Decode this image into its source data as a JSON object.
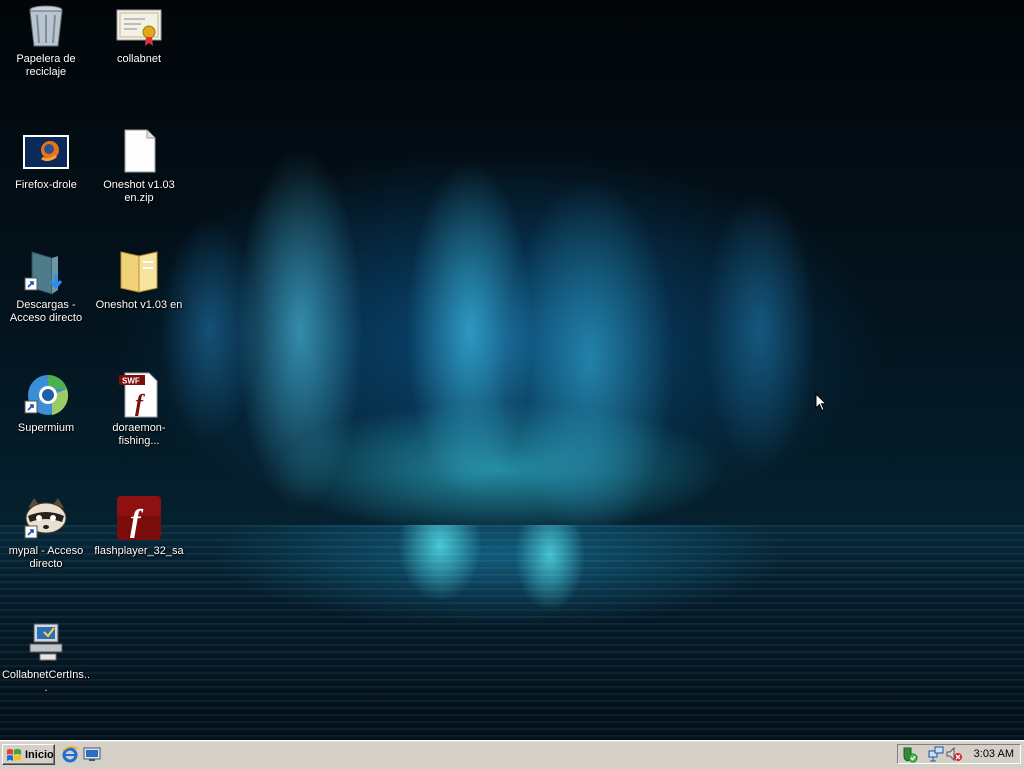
{
  "desktop_icons": [
    {
      "id": "recycle-bin",
      "label": "Papelera de reciclaje",
      "icon": "recycle-bin-icon"
    },
    {
      "id": "collabnet",
      "label": "collabnet",
      "icon": "certificate-icon"
    },
    {
      "id": "firefox-drole",
      "label": "Firefox-drole",
      "icon": "firefox-image-icon"
    },
    {
      "id": "oneshot-zip",
      "label": "Oneshot v1.03 en.zip",
      "icon": "blank-file-icon"
    },
    {
      "id": "descargas",
      "label": "Descargas - Acceso directo",
      "icon": "downloads-folder-shortcut-icon"
    },
    {
      "id": "oneshot-folder",
      "label": "Oneshot v1.03 en",
      "icon": "folder-icon"
    },
    {
      "id": "supermium",
      "label": "Supermium",
      "icon": "supermium-browser-icon"
    },
    {
      "id": "doraemon",
      "label": "doraemon-fishing...",
      "icon": "swf-file-icon"
    },
    {
      "id": "mypal",
      "label": "mypal - Acceso directo",
      "icon": "raccoon-shortcut-icon"
    },
    {
      "id": "flashplayer",
      "label": "flashplayer_32_sa",
      "icon": "flash-player-icon"
    },
    {
      "id": "collabnetcert",
      "label": "CollabnetCertIns...",
      "icon": "computer-install-icon"
    }
  ],
  "taskbar": {
    "start_label": "Inicio",
    "quick_launch": [
      "internet-explorer-icon",
      "show-desktop-icon"
    ],
    "tray_icons": [
      "security-shield-icon",
      "network-icon",
      "volume-muted-icon"
    ],
    "clock": "3:03 AM"
  },
  "colors": {
    "taskbar": "#d4d0c8",
    "flash_red": "#7a0c0c"
  }
}
